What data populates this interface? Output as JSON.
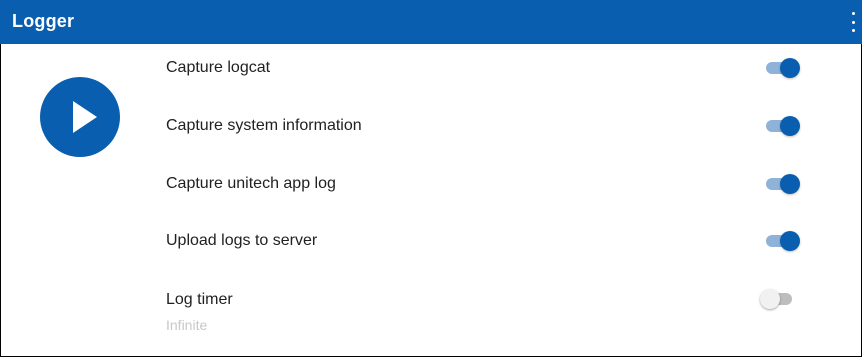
{
  "app": {
    "title": "Logger",
    "accent_color": "#0a5eb0"
  },
  "toolbar": {
    "overflow_icon": "more-vert-icon"
  },
  "main": {
    "start_button_icon": "play-icon",
    "settings": [
      {
        "label": "Capture logcat",
        "enabled": true
      },
      {
        "label": "Capture system information",
        "enabled": true
      },
      {
        "label": "Capture unitech app log",
        "enabled": true
      },
      {
        "label": "Upload logs to server",
        "enabled": true
      },
      {
        "label": "Log timer",
        "sublabel": "Infinite",
        "enabled": false
      }
    ]
  }
}
